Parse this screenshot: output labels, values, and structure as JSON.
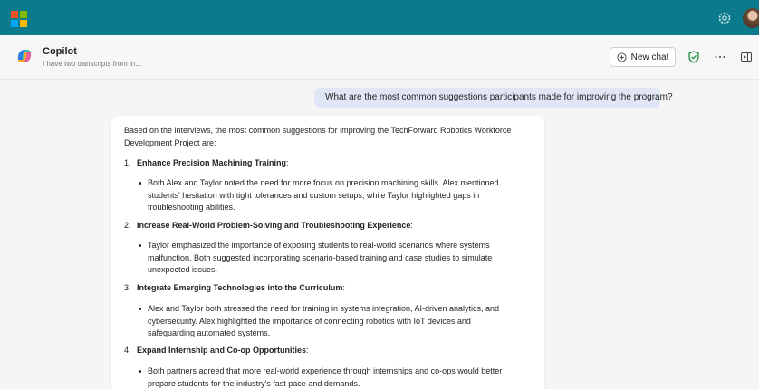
{
  "topbar": {
    "logo_icon": "microsoft-logo-icon",
    "settings_icon": "gear-icon",
    "avatar_icon": "user-avatar"
  },
  "header": {
    "title": "Copilot",
    "subtitle": "I have two transcripts from in...",
    "new_chat_label": "New chat",
    "icons": [
      "add-circle-icon",
      "shield-check-icon",
      "more-icon",
      "side-panel-icon"
    ]
  },
  "user_message": "What are the most common suggestions participants made for improving the program?",
  "answer": {
    "intro_line1": "Based on the interviews, the most common suggestions for improving the TechForward Robotics Workforce",
    "intro_line2": "Development Project are:",
    "items": [
      {
        "number": "1.",
        "heading": "Enhance Precision Machining Training",
        "suffix": ":",
        "lines": [
          "Both Alex and Taylor noted the need for more focus on precision machining skills. Alex mentioned",
          "students' hesitation with tight tolerances and custom setups, while Taylor highlighted gaps in",
          "troubleshooting abilities."
        ]
      },
      {
        "number": "2.",
        "heading": "Increase Real-World Problem-Solving and Troubleshooting Experience",
        "suffix": ":",
        "lines": [
          "Taylor emphasized the importance of exposing students to real-world scenarios where systems",
          "malfunction. Both suggested incorporating scenario-based training and case studies to simulate",
          "unexpected issues."
        ]
      },
      {
        "number": "3.",
        "heading": "Integrate Emerging Technologies into the Curriculum",
        "suffix": ":",
        "lines": [
          "Alex and Taylor both stressed the need for training in systems integration, AI-driven analytics, and",
          "cybersecurity. Alex highlighted the importance of connecting robotics with IoT devices and",
          "safeguarding automated systems."
        ]
      },
      {
        "number": "4.",
        "heading": "Expand Internship and Co-op Opportunities",
        "suffix": ":",
        "lines": [
          "Both partners agreed that more real-world experience through internships and co-ops would better",
          "prepare students for the industry's fast pace and demands."
        ]
      }
    ]
  },
  "colors": {
    "topbar": "#0b7a8c",
    "user_bubble": "#e1e6f6",
    "shield": "#1e8e3e"
  }
}
